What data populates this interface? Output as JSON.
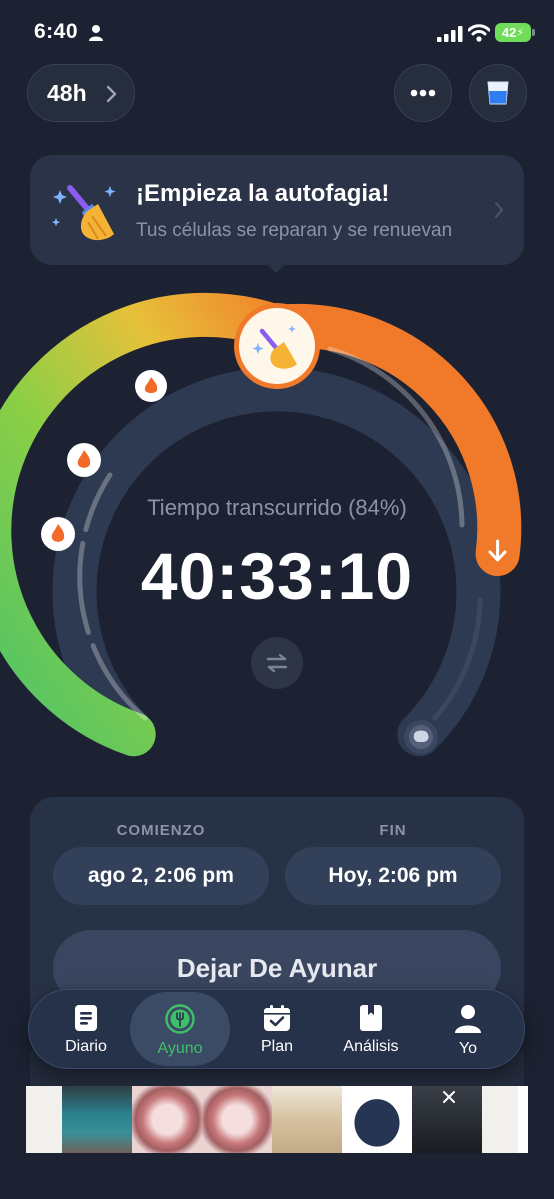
{
  "status_bar": {
    "time": "6:40",
    "battery": "42"
  },
  "top_bar": {
    "duration_label": "48h"
  },
  "banner": {
    "title": "¡Empieza la autofagia!",
    "subtitle": "Tus células se reparan y se renuevan"
  },
  "progress": {
    "label": "Tiempo transcurrido (84%)",
    "timer": "40:33:10",
    "fraction": 0.84
  },
  "schedule": {
    "start_label": "COMIENZO",
    "start_value": "ago 2, 2:06 pm",
    "end_label": "FIN",
    "end_value": "Hoy, 2:06 pm",
    "stop_button": "Dejar De Ayunar"
  },
  "tabs": [
    {
      "label": "Diario",
      "icon": "journal-icon",
      "active": false
    },
    {
      "label": "Ayuno",
      "icon": "fork-icon",
      "active": true
    },
    {
      "label": "Plan",
      "icon": "calendar-icon",
      "active": false
    },
    {
      "label": "Análisis",
      "icon": "book-icon",
      "active": false
    },
    {
      "label": "Yo",
      "icon": "person-icon",
      "active": false
    }
  ],
  "colors": {
    "background": "#1c2232",
    "accent_green": "#3fbf6a",
    "accent_orange": "#f07a2a",
    "ring_track": "#2e3a52"
  }
}
